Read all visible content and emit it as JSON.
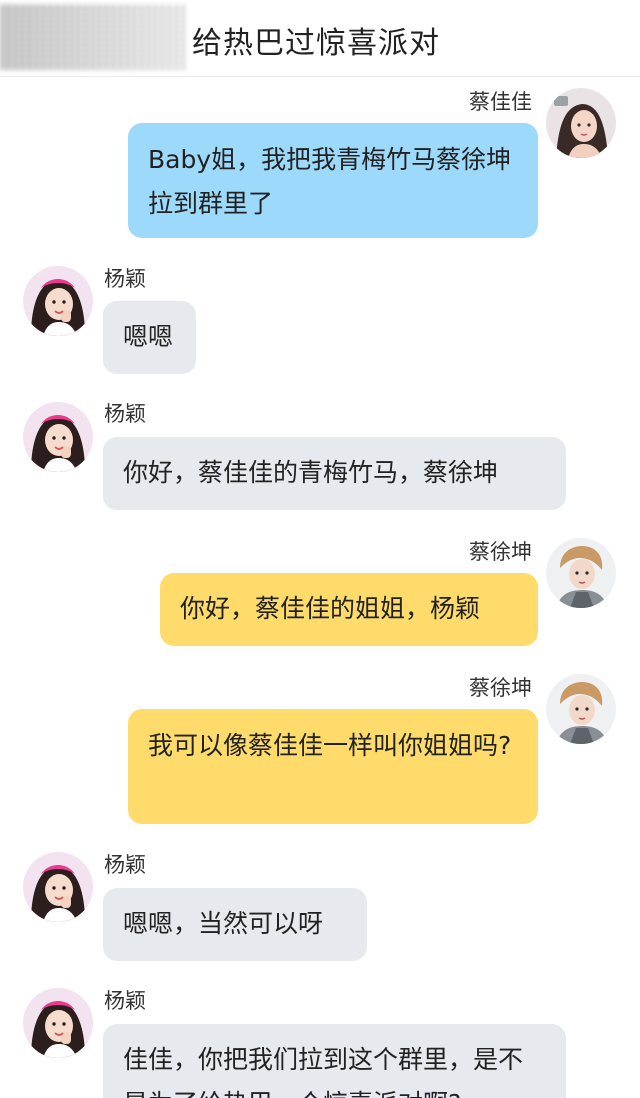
{
  "header": {
    "title": "给热巴过惊喜派对"
  },
  "messages": [
    {
      "name": "蔡佳佳",
      "text": "Baby姐，我把我青梅竹马蔡徐坤拉到群里了",
      "avatar_icon": "girl-avatar-icon"
    },
    {
      "name": "杨颖",
      "text": "嗯嗯",
      "avatar_icon": "angelababy-avatar-icon"
    },
    {
      "name": "杨颖",
      "text": "你好，蔡佳佳的青梅竹马，蔡徐坤",
      "avatar_icon": "angelababy-avatar-icon"
    },
    {
      "name": "蔡徐坤",
      "text": "你好，蔡佳佳的姐姐，杨颖",
      "avatar_icon": "boy-avatar-icon"
    },
    {
      "name": "蔡徐坤",
      "text": "我可以像蔡佳佳一样叫你姐姐吗?",
      "avatar_icon": "boy-avatar-icon"
    },
    {
      "name": "杨颖",
      "text": "嗯嗯，当然可以呀",
      "avatar_icon": "angelababy-avatar-icon"
    },
    {
      "name": "杨颖",
      "text": "佳佳，你把我们拉到这个群里，是不是为了给热巴一个惊喜派对啊?",
      "avatar_icon": "angelababy-avatar-icon"
    }
  ],
  "colors": {
    "blue_bubble": "#9dd9fb",
    "gray_bubble": "#e6e9ee",
    "yellow_bubble": "#fedb6b"
  }
}
